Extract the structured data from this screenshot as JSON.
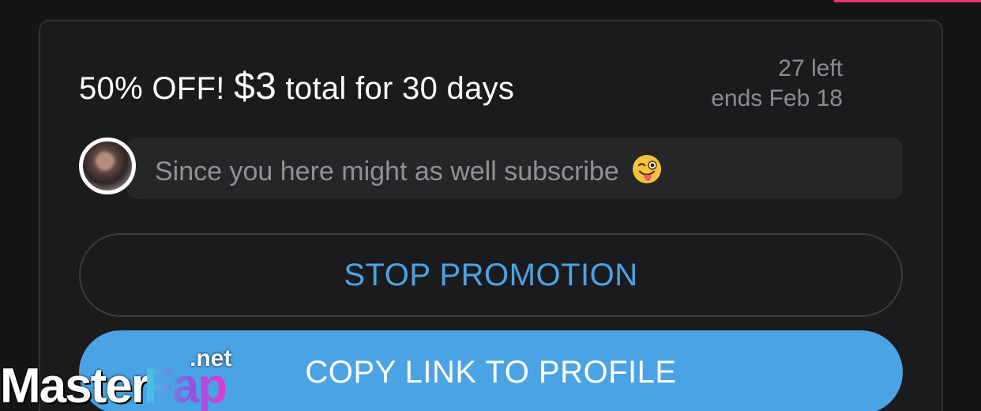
{
  "promo": {
    "title_prefix": "50% OFF!",
    "price": "$3",
    "title_suffix": "total for 30 days",
    "left_text": "27 left",
    "ends_text": "ends Feb 18"
  },
  "message": {
    "text": "Since you here might as well subscribe",
    "emoji": "winking-face-with-tongue-icon"
  },
  "buttons": {
    "stop_label": "STOP PROMOTION",
    "copy_label": "COPY LINK TO PROFILE"
  },
  "watermark": {
    "part1": "Master",
    "part2": "Fap",
    "suffix": ".net"
  },
  "colors": {
    "accent_blue": "#4aa3e4",
    "accent_pink": "#e4356f",
    "background": "#151516"
  }
}
